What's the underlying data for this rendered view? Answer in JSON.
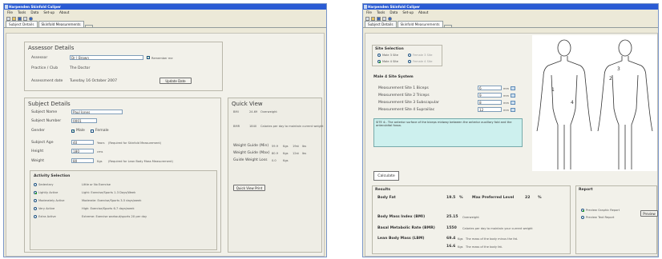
{
  "app": {
    "title": "Harpenden Skinfold Caliper"
  },
  "menu": [
    "File",
    "Tools",
    "Data",
    "Set-up",
    "About"
  ],
  "left": {
    "tabs": [
      "Subject Details",
      "Skinfold Measurements"
    ],
    "assessor": {
      "heading": "Assessor Details",
      "assessor_label": "Assessor",
      "assessor_value": "Dr J Brown",
      "remember_label": "Remember me",
      "remember_checked": true,
      "practice_label": "Practice / Club",
      "practice_value": "The Doctor",
      "date_label": "Assessment date",
      "date_value": "Tuesday 16 October 2007",
      "update_button": "Update Date"
    },
    "subject": {
      "heading": "Subject Details",
      "name_label": "Subject Name",
      "name_value": "Paul Jones",
      "number_label": "Subject Number",
      "number_value": "0001",
      "gender_label": "Gender",
      "male_label": "Male",
      "female_label": "Female",
      "gender_selected": "Male",
      "age_label": "Subject Age",
      "age_value": "40",
      "age_unit": "Years",
      "age_note": "(Required for Skinfold Measurement)",
      "height_label": "Height",
      "height_value": "180",
      "height_unit": "cms",
      "weight_label": "Weight",
      "weight_value": "80",
      "weight_unit": "Kgs",
      "weight_note": "(Required for Lean Body Mass Measurement)"
    },
    "activity": {
      "heading": "Activity Selection",
      "selected_index": 1,
      "items": [
        {
          "name": "Sedentary",
          "desc": "Little or No Exercise"
        },
        {
          "name": "Lightly Active",
          "desc": "Light: Exercise/Sports 1-3 Days/Week"
        },
        {
          "name": "Moderately Active",
          "desc": "Moderate: Exercise/Sports 3-5 days/week"
        },
        {
          "name": "Very Active",
          "desc": "High: Exercise/Sports 6-7 days/week"
        },
        {
          "name": "Extra Active",
          "desc": "Extreme: Exercise workout/sports 2X per day"
        }
      ]
    },
    "quickview": {
      "heading": "Quick View",
      "bmi_label": "BMI",
      "bmi_value": "24.69",
      "bmi_note": "Overweight",
      "bmr_label": "BMR",
      "bmr_value": "1840",
      "bmr_note": "Calories per day to maintain current weight",
      "wg1_label": "Weight Guide (Min)",
      "wg1_value": "59.9",
      "wg1_unit": "Kgs",
      "wg1_lb": "19st",
      "wg1_lb_unit": "lbs",
      "wg2_label": "Weight Guide (Max)",
      "wg2_value": "80.9",
      "wg2_unit": "Kgs",
      "wg2_lb": "12st",
      "wg2_lb_unit": "lbs",
      "wg3_label": "Guide Weight Loss",
      "wg3_value": "0.0",
      "wg3_unit": "Kgs",
      "button": "Quick View Print"
    }
  },
  "right": {
    "tabs": [
      "Subject Details",
      "Skinfold Measurements"
    ],
    "site_selection": {
      "heading": "Site Selection",
      "options": [
        "Male 3 Site",
        "Female 3 Site",
        "Male 4 Site",
        "Female 4 Site"
      ],
      "selected": "Male 4 Site"
    },
    "site_system": {
      "heading": "Male 4 Site System",
      "rows": [
        {
          "label": "Measurement Site 1 Biceps",
          "value": "6",
          "unit": "mm"
        },
        {
          "label": "Measurement Site 2 Triceps",
          "value": "9",
          "unit": "mm"
        },
        {
          "label": "Measurement Site 3 Subscapular",
          "value": "8",
          "unit": "mm"
        },
        {
          "label": "Measurement Site 4 Suprailiac",
          "value": "12",
          "unit": "mm"
        }
      ],
      "help_text": "SITE 4:- The anterior surface of the biceps midway between the anterior auxillary fold and the antecubital fossa."
    },
    "calculate_button": "Calculate",
    "results": {
      "heading": "Results",
      "bodyfat_label": "Body Fat",
      "bodyfat_value": "19.5",
      "bodyfat_unit": "%",
      "max_label": "Max Preferred Level",
      "max_value": "22",
      "max_unit": "%",
      "bmi_label": "Body Mass Index (BMI)",
      "bmi_value": "25.15",
      "bmi_note": "Overweight",
      "bmr_label": "Basal Metabolic Rate (BMR)",
      "bmr_value": "1550",
      "bmr_note": "Calories per day to maintain your current weight",
      "lbm_label": "Lean Body Mass (LBM)",
      "lbm_value": "69.4",
      "lbm_unit": "Kgs",
      "lbm_note": "The mass of the body minus the fat.",
      "fat_value": "16.6",
      "fat_unit": "Kgs",
      "fat_note": "The mass of the body fat."
    },
    "report": {
      "heading": "Report",
      "options": [
        "Preview Graphic Report",
        "Preview Text Report"
      ],
      "selected": "Preview Graphic Report",
      "button": "Preview"
    },
    "diagram": {
      "labels": [
        "1",
        "2",
        "3",
        "4"
      ]
    }
  }
}
